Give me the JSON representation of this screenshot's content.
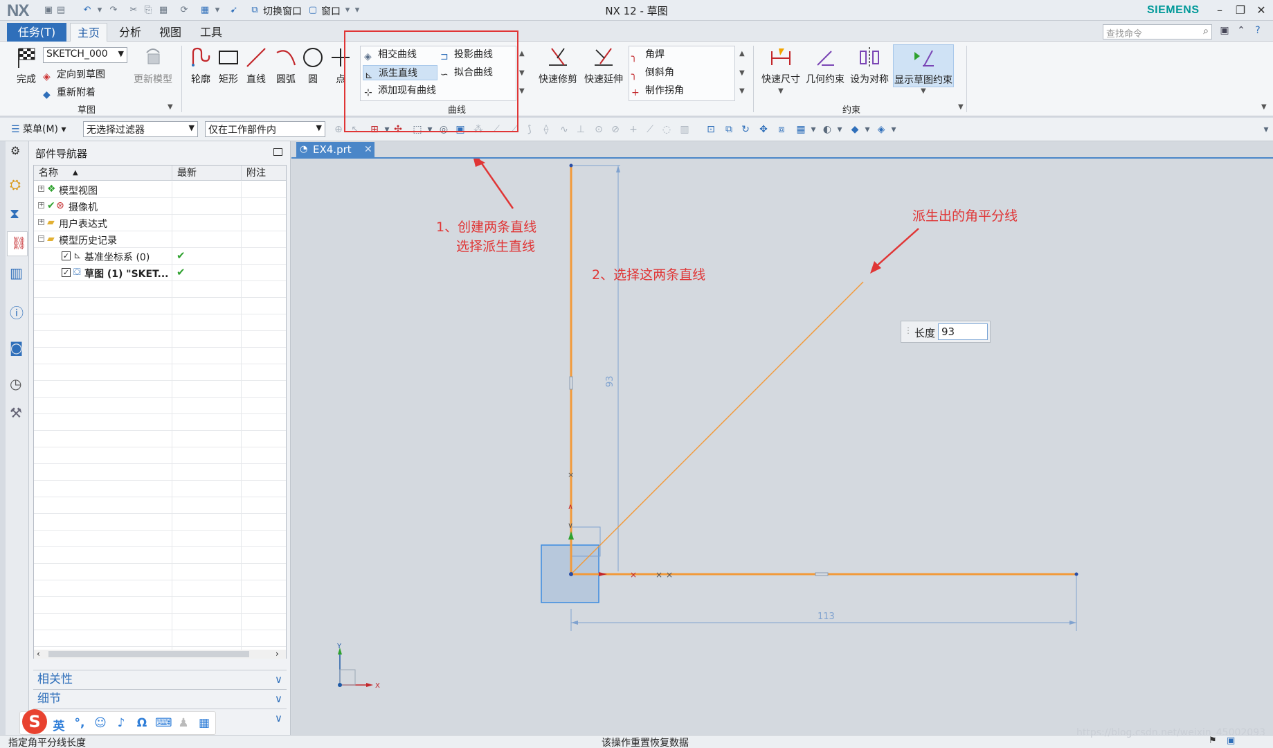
{
  "app": {
    "logo": "NX",
    "title": "NX 12 - 草图",
    "brand": "SIEMENS"
  },
  "quick_access": {
    "switch_window": "切换窗口",
    "window": "窗口"
  },
  "ribbon_tabs": {
    "task": "任务(T)",
    "tabs": [
      "主页",
      "分析",
      "视图",
      "工具"
    ]
  },
  "search": {
    "placeholder": "查找命令"
  },
  "ribbon": {
    "sketch_group": {
      "finish": "完成",
      "sketch_name": "SKETCH_000",
      "orient_to_sketch": "定向到草图",
      "reattach": "重新附着",
      "update_model": "更新模型",
      "label": "草图"
    },
    "draw": [
      "轮廓",
      "矩形",
      "直线",
      "圆弧",
      "圆",
      "点"
    ],
    "curve_group": {
      "intersection_curve": "相交曲线",
      "project_curve": "投影曲线",
      "derived_lines": "派生直线",
      "fit_curve": "拟合曲线",
      "add_existing_curves": "添加现有曲线",
      "label": "曲线"
    },
    "edit": {
      "quick_trim": "快速修剪",
      "quick_extend": "快速延伸"
    },
    "corner": {
      "fillet": "角焊",
      "chamfer": "倒斜角",
      "make_corner": "制作拐角"
    },
    "constraints_group": {
      "rapid_dimension": "快速尺寸",
      "geometric_constraints": "几何约束",
      "make_symmetric": "设为对称",
      "show_sketch_constraints": "显示草图约束",
      "label": "约束"
    }
  },
  "toolbar2": {
    "menu": "菜单(M)",
    "selection_filter": "无选择过滤器",
    "scope": "仅在工作部件内"
  },
  "navigator": {
    "title": "部件导航器",
    "columns": [
      "名称",
      "最新",
      "附注"
    ],
    "rows": [
      {
        "name": "模型视图",
        "latest": ""
      },
      {
        "name": "摄像机",
        "latest": ""
      },
      {
        "name": "用户表达式",
        "latest": ""
      },
      {
        "name": "模型历史记录",
        "latest": ""
      },
      {
        "name": "基准坐标系 (0)",
        "latest": "✔"
      },
      {
        "name": "草图 (1) \"SKET...",
        "latest": "✔"
      }
    ],
    "sections": [
      "相关性",
      "细节",
      ""
    ]
  },
  "ime": {
    "lang": "英"
  },
  "document": {
    "tab": "EX4.prt"
  },
  "canvas": {
    "vertical_dim": "93",
    "horizontal_dim": "113",
    "axis_x": "X",
    "axis_y": "Y"
  },
  "length_input": {
    "label": "长度",
    "value": "93"
  },
  "annotations": {
    "step1_line1": "1、创建两条直线",
    "step1_line2": "选择派生直线",
    "step2": "2、选择这两条直线",
    "bisector": "派生出的角平分线"
  },
  "status": {
    "left": "指定角平分线长度",
    "center": "该操作重置恢复数据"
  },
  "watermark": "https://blog.csdn.net/weixin_45002093",
  "colors": {
    "accent": "#2f6fba",
    "sketch_orange": "#f29a3a",
    "annotation_red": "#e03535",
    "dimension_blue": "#7fa2cf"
  }
}
